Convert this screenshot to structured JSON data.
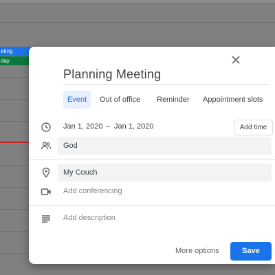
{
  "background": {
    "events": [
      {
        "label": "eting",
        "color": "#1a73e8"
      },
      {
        "label": "day",
        "color": "#0a7a3c"
      }
    ],
    "now_line_color": "#c5221f"
  },
  "dialog": {
    "title": "Planning Meeting",
    "tabs": [
      "Event",
      "Out of office",
      "Reminder",
      "Appointment slots"
    ],
    "active_tab": "Event",
    "start_date": "Jan 1, 2020",
    "date_separator": "–",
    "end_date": "Jan 1, 2020",
    "add_time_label": "Add time",
    "guests_value": "God",
    "location_value": "My Couch",
    "conferencing_placeholder": "Add conferencing",
    "description_placeholder": "Add description",
    "more_options_label": "More options",
    "save_label": "Save",
    "accent_color": "#1a73e8"
  },
  "icons": {
    "close": "close-icon",
    "clock": "clock-icon",
    "guests": "people-icon",
    "location": "location-pin-icon",
    "video": "video-icon",
    "description": "notes-icon"
  }
}
